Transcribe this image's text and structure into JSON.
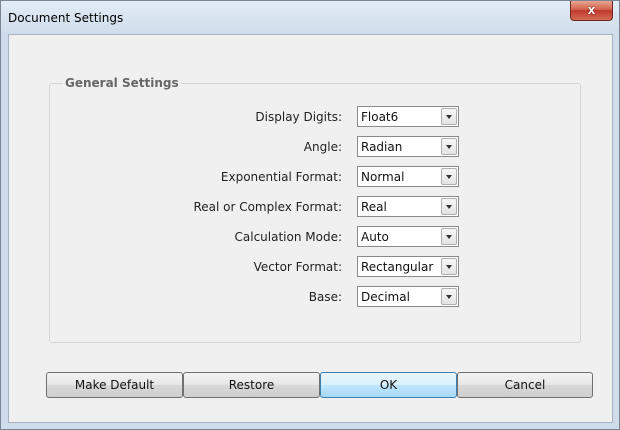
{
  "window": {
    "title": "Document Settings",
    "close_label": "x"
  },
  "group": {
    "title": "General Settings"
  },
  "settings": [
    {
      "label": "Display Digits:",
      "value": "Float6"
    },
    {
      "label": "Angle:",
      "value": "Radian"
    },
    {
      "label": "Exponential Format:",
      "value": "Normal"
    },
    {
      "label": "Real or Complex Format:",
      "value": "Real"
    },
    {
      "label": "Calculation Mode:",
      "value": "Auto"
    },
    {
      "label": "Vector Format:",
      "value": "Rectangular"
    },
    {
      "label": "Base:",
      "value": "Decimal"
    }
  ],
  "buttons": {
    "make_default": "Make Default",
    "restore": "Restore",
    "ok": "OK",
    "cancel": "Cancel"
  }
}
